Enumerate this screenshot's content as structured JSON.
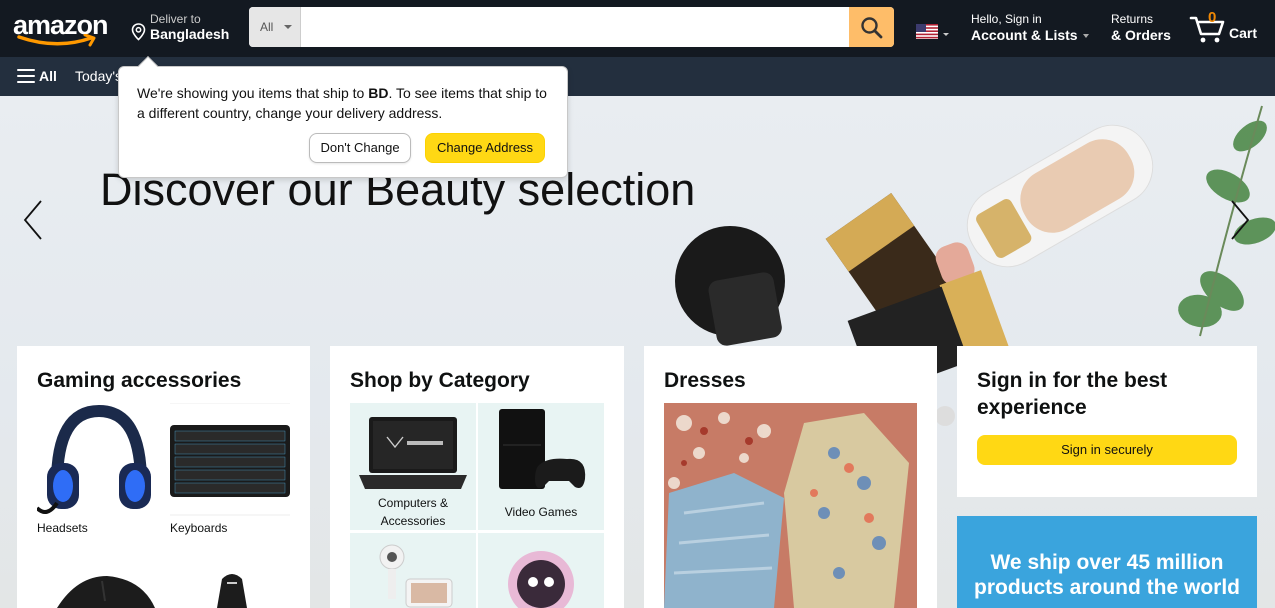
{
  "header": {
    "logo_text": "amazon",
    "deliver_to_label": "Deliver to",
    "deliver_to_country": "Bangladesh",
    "search_category": "All",
    "search_placeholder": "",
    "account_greeting": "Hello, Sign in",
    "account_label": "Account & Lists",
    "returns_label": "Returns",
    "orders_label": "& Orders",
    "cart_count": "0",
    "cart_label": "Cart"
  },
  "subnav": {
    "all_label": "All",
    "todays_deals_label": "Today's"
  },
  "popover": {
    "message_before": "We're showing you items that ship to ",
    "message_country": "BD",
    "message_after": ". To see items that ship to a different country, change your delivery address.",
    "dont_change_label": "Don't Change",
    "change_address_label": "Change Address"
  },
  "hero": {
    "title": "Discover our Beauty selection"
  },
  "cards": {
    "gaming": {
      "title": "Gaming accessories",
      "items": [
        "Headsets",
        "Keyboards"
      ]
    },
    "category": {
      "title": "Shop by Category",
      "items": [
        "Computers &",
        "Accessories",
        "Video Games"
      ]
    },
    "dresses": {
      "title": "Dresses"
    },
    "signin": {
      "title": "Sign in for the best experience",
      "button_label": "Sign in securely"
    },
    "ship_banner": {
      "text": "We ship over 45 million products around the world"
    }
  },
  "colors": {
    "nav_top": "#131921",
    "nav_sub": "#232f3e",
    "search_button": "#febd69",
    "primary_button": "#ffd814",
    "cart_count": "#f08804",
    "ship_banner": "#3aa4dd"
  }
}
